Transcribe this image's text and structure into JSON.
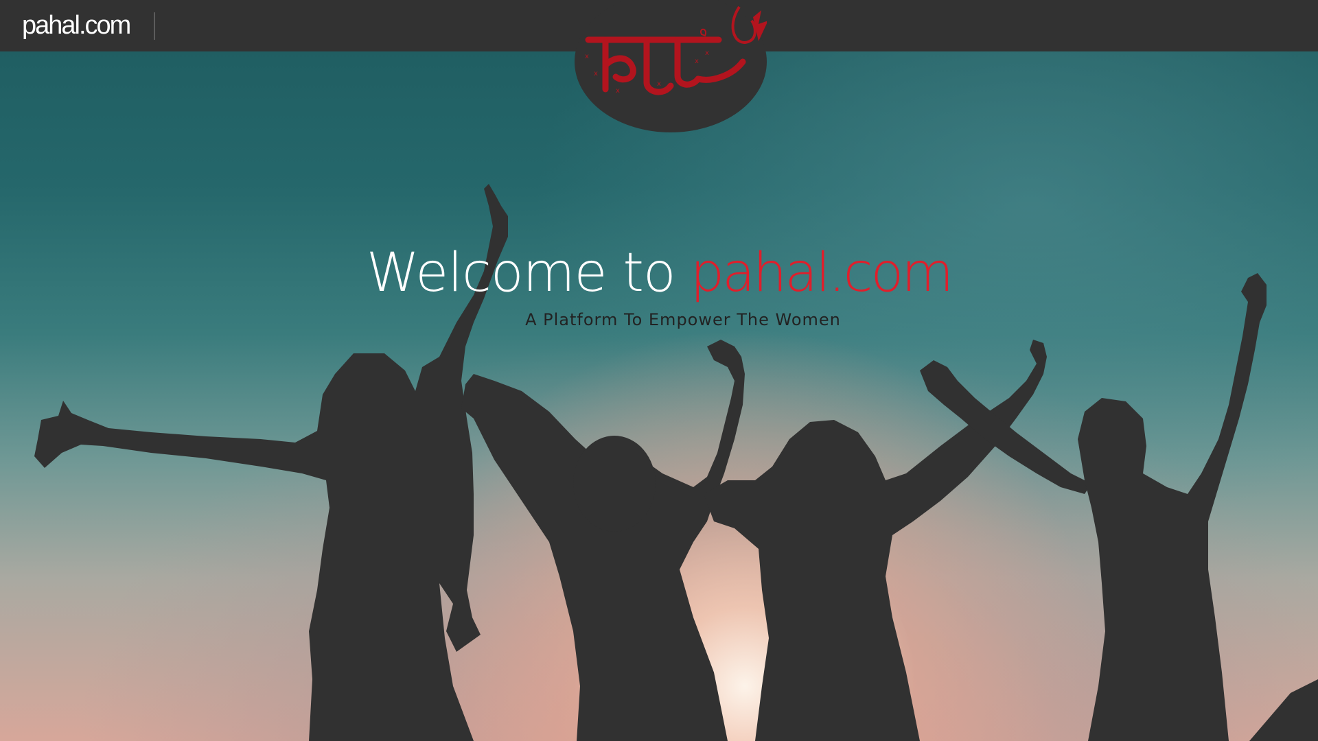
{
  "header": {
    "brand": "pahal.com"
  },
  "logo": {
    "icon": "pahal-hindi-logo",
    "text": "पहल"
  },
  "hero": {
    "welcome_prefix": "Welcome to",
    "welcome_brand": "pahal.com",
    "tagline": "A Platform To Empower The Women",
    "image": "women-silhouettes-sunset-photo"
  },
  "colors": {
    "topbar": "#323232",
    "accent": "#e01e2b",
    "logo_red": "#b3141e",
    "silhouette": "#313131"
  }
}
